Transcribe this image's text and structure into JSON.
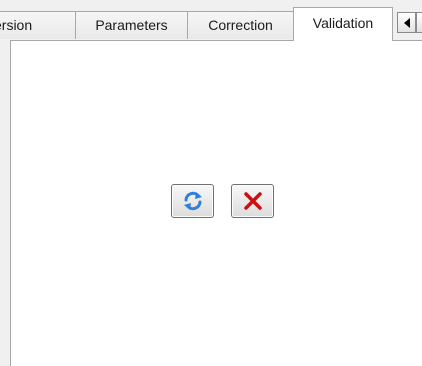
{
  "tabs": [
    {
      "label": "ersion",
      "active": false
    },
    {
      "label": "Parameters",
      "active": false
    },
    {
      "label": "Correction",
      "active": false
    },
    {
      "label": "Validation",
      "active": true
    }
  ],
  "icons": {
    "tab_scroll_left": "triangle-left-icon",
    "refresh": "refresh-icon",
    "cancel": "red-x-icon"
  },
  "colors": {
    "refresh_blue": "#2f7fd9",
    "cancel_red": "#cc1010",
    "panel_bg": "#ffffff",
    "window_bg": "#f0f0f0"
  }
}
